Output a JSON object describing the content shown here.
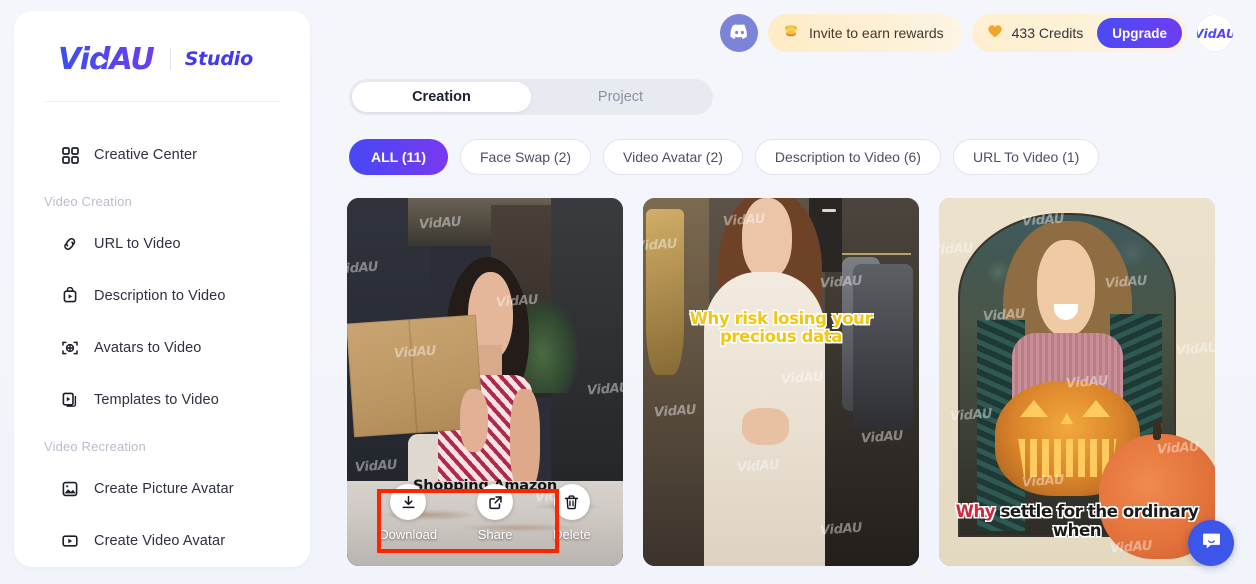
{
  "brand": {
    "logo": "VidAU",
    "product": "Studio"
  },
  "sidebar": {
    "top_items": [
      {
        "label": "Creative Center",
        "icon": "grid-icon"
      }
    ],
    "groups": [
      {
        "title": "Video Creation",
        "items": [
          {
            "label": "URL to Video",
            "icon": "link-icon"
          },
          {
            "label": "Description to Video",
            "icon": "script-icon"
          },
          {
            "label": "Avatars to Video",
            "icon": "avatar-frame-icon"
          },
          {
            "label": "Templates to Video",
            "icon": "templates-icon"
          }
        ]
      },
      {
        "title": "Video Recreation",
        "items": [
          {
            "label": "Create Picture Avatar",
            "icon": "image-icon"
          },
          {
            "label": "Create Video Avatar",
            "icon": "video-icon"
          }
        ]
      }
    ]
  },
  "topbar": {
    "discord_icon": "discord-icon",
    "invite": {
      "label": "Invite to earn rewards",
      "icon": "coins-icon"
    },
    "credits": {
      "label": "433 Credits",
      "icon": "heart-coin-icon"
    },
    "upgrade_label": "Upgrade",
    "avatar_label": "VidAU"
  },
  "tabs": [
    {
      "label": "Creation",
      "active": true
    },
    {
      "label": "Project",
      "active": false
    }
  ],
  "filters": [
    {
      "label": "ALL (11)",
      "active": true
    },
    {
      "label": "Face Swap (2)",
      "active": false
    },
    {
      "label": "Video Avatar (2)",
      "active": false
    },
    {
      "label": "Description to Video (6)",
      "active": false
    },
    {
      "label": "URL To Video (1)",
      "active": false
    }
  ],
  "cards": [
    {
      "id": "card-1",
      "watermark": "VidAU",
      "title": "Shopping    Amazon",
      "actions": [
        {
          "label": "Download",
          "icon": "download-icon"
        },
        {
          "label": "Share",
          "icon": "share-icon"
        },
        {
          "label": "Delete",
          "icon": "trash-icon"
        }
      ]
    },
    {
      "id": "card-2",
      "watermark": "VidAU",
      "caption": "Why risk losing your precious data"
    },
    {
      "id": "card-3",
      "watermark": "VidAU",
      "caption_highlight": "Why",
      "caption_rest": " settle for the ordinary when"
    }
  ],
  "chat": {
    "icon": "chat-bubble-icon"
  },
  "colors": {
    "accent": "#4a4bf5",
    "accent2": "#7a39f0",
    "annotation": "#fd2400",
    "credit_pill": "#fdefcf",
    "caption_yellow": "#f2c617",
    "caption_red": "#d2263a"
  }
}
